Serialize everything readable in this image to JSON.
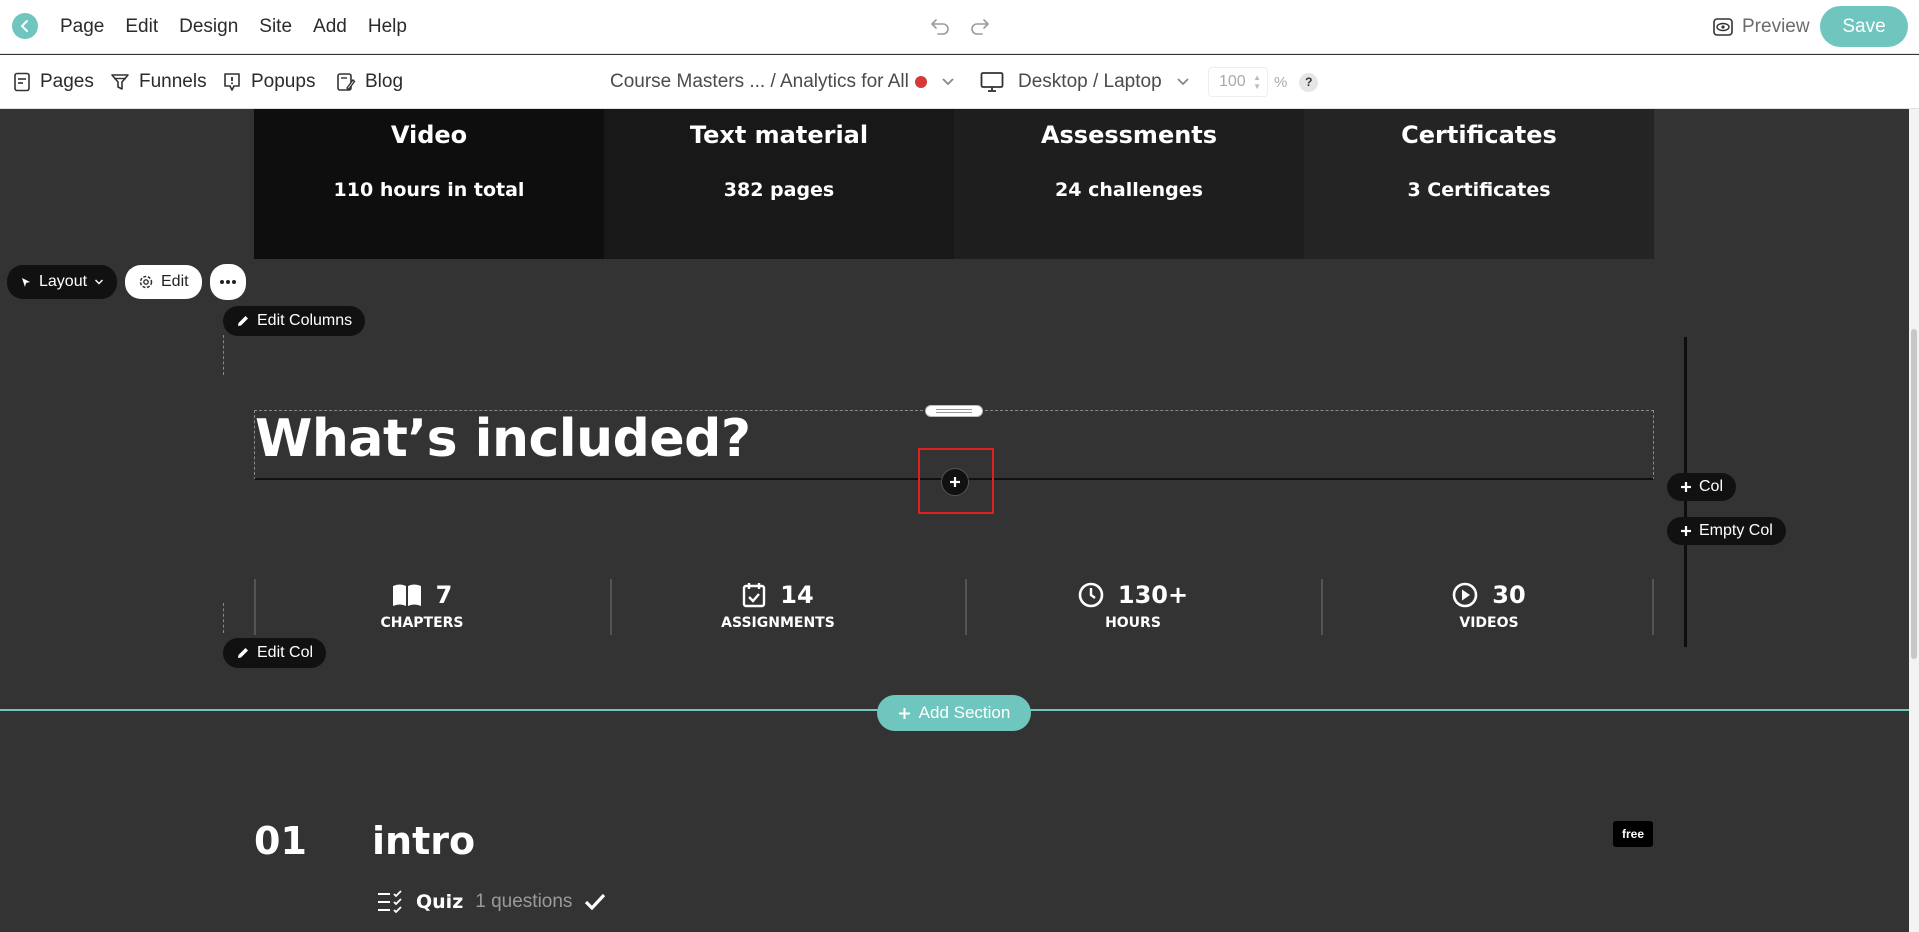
{
  "topbar": {
    "menu": [
      "Page",
      "Edit",
      "Design",
      "Site",
      "Add",
      "Help"
    ],
    "preview_label": "Preview",
    "save_label": "Save"
  },
  "subbar": {
    "nav": [
      "Pages",
      "Funnels",
      "Popups",
      "Blog"
    ],
    "page_select": "Course Masters ... / Analytics for All",
    "device": "Desktop / Laptop",
    "zoom_value": "100",
    "zoom_unit": "%",
    "help": "?"
  },
  "stats": [
    {
      "title": "Video",
      "value": "110 hours in total"
    },
    {
      "title": "Text material",
      "value": "382 pages"
    },
    {
      "title": "Assessments",
      "value": "24 challenges"
    },
    {
      "title": "Certificates",
      "value": "3 Certificates"
    }
  ],
  "toolbar": {
    "layout_label": "Layout",
    "edit_label": "Edit",
    "edit_columns_label": "Edit Columns",
    "edit_col_label": "Edit Col",
    "add_col_label": "Col",
    "add_empty_col_label": "Empty Col",
    "add_section_label": "Add Section"
  },
  "heading": "What’s included?",
  "counters": [
    {
      "value": "7",
      "label": "CHAPTERS",
      "icon": "book-icon"
    },
    {
      "value": "14",
      "label": "ASSIGNMENTS",
      "icon": "calendar-check-icon"
    },
    {
      "value": "130+",
      "label": "HOURS",
      "icon": "clock-icon"
    },
    {
      "value": "30",
      "label": "VIDEOS",
      "icon": "play-circle-icon"
    }
  ],
  "lesson": {
    "number": "01",
    "title": "intro",
    "badge": "free",
    "quiz_label": "Quiz",
    "quiz_count": "1 questions"
  },
  "colors": {
    "accent": "#6ec6bf",
    "canvas": "#333333",
    "highlight": "#e01f1f",
    "status_dot": "#d63838"
  }
}
